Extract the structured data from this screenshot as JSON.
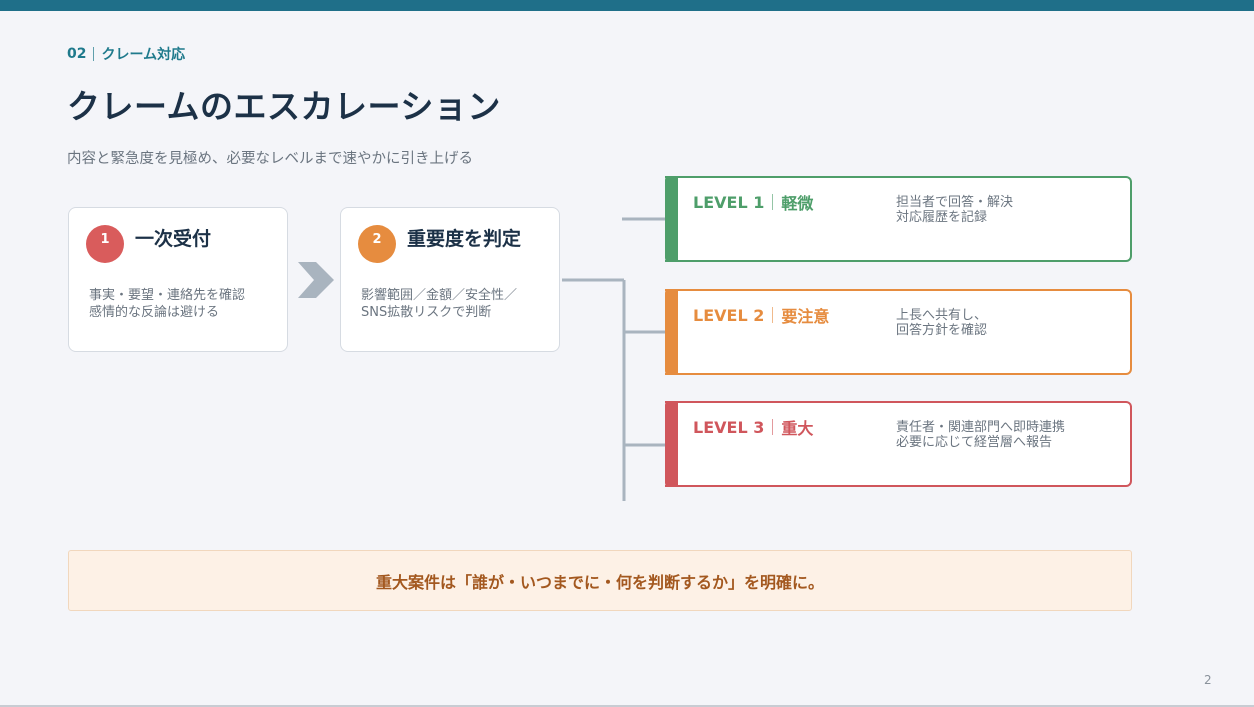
{
  "section": {
    "number": "02",
    "name": "クレーム対応"
  },
  "title": "クレームのエスカレーション",
  "subtitle": "内容と緊急度を見極め、必要なレベルまで速やかに引き上げる",
  "steps": [
    {
      "num": "1",
      "title": "一次受付",
      "desc": [
        "事実・要望・連絡先を確認",
        "感情的な反論は避ける"
      ],
      "color": "#d95c5c"
    },
    {
      "num": "2",
      "title": "重要度を判定",
      "desc": [
        "影響範囲／金額／安全性／",
        "SNS拡散リスクで判断"
      ],
      "color": "#e68c3f"
    }
  ],
  "levels": [
    {
      "label": "LEVEL 1",
      "name": "軽微",
      "desc": [
        "担当者で回答・解決",
        "対応履歴を記録"
      ],
      "color": "#4e9e6a"
    },
    {
      "label": "LEVEL 2",
      "name": "要注意",
      "desc": [
        "上長へ共有し、",
        "回答方針を確認"
      ],
      "color": "#e68c3f"
    },
    {
      "label": "LEVEL 3",
      "name": "重大",
      "desc": [
        "責任者・関連部門へ即時連携",
        "必要に応じて経営層へ報告"
      ],
      "color": "#d0565c"
    }
  ],
  "callout": "重大案件は「誰が・いつまでに・何を判断するか」を明確に。",
  "page_number": "2",
  "colors": {
    "brand": "#1f6f89",
    "line": "#a9b4bf"
  }
}
